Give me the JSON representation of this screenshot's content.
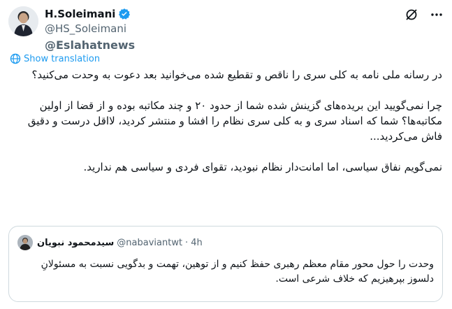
{
  "author": {
    "display_name": "H.Soleimani",
    "handle": "@HS_Soleimani",
    "verified": true
  },
  "watermark": "@Eslahatnews",
  "actions": {
    "show_translation": "Show translation",
    "icons": [
      "grok-icon",
      "more-icon",
      "translate-icon"
    ]
  },
  "tweet": {
    "paragraphs": [
      "در رسانه ملی نامه به کلی سری را ناقص و تقطیع شده می‌خوانید بعد دعوت به وحدت می‌کنید؟",
      "چرا نمی‌گویید این بریده‌های گزینش شده شما از حدود ۲۰ و چند مکاتبه بوده و از قضا از اولین مکاتبه‌ها؟ شما که اسناد سری و به کلی سری نظام را افشا و منتشر کردید، لااقل درست و دقیق فاش می‌کردید...",
      "نمی‌گویم نفاق سیاسی، اما امانت‌دار نظام نبودید، تقوای فردی و سیاسی هم ندارید."
    ]
  },
  "quote": {
    "name": "سیدمحمود نبویان",
    "handle": "@nabaviantwt",
    "separator": "·",
    "time": "4h",
    "text": "وحدت را حول محور مقام معظم رهبری حفظ کنیم و از توهین، تهمت و بدگویی نسبت به مسئولانِ دلسوز بپرهیزیم که خلاف شرعی است."
  },
  "colors": {
    "link": "#1d9bf0",
    "muted": "#536471",
    "border": "#cfd9de",
    "text": "#0f1419"
  }
}
